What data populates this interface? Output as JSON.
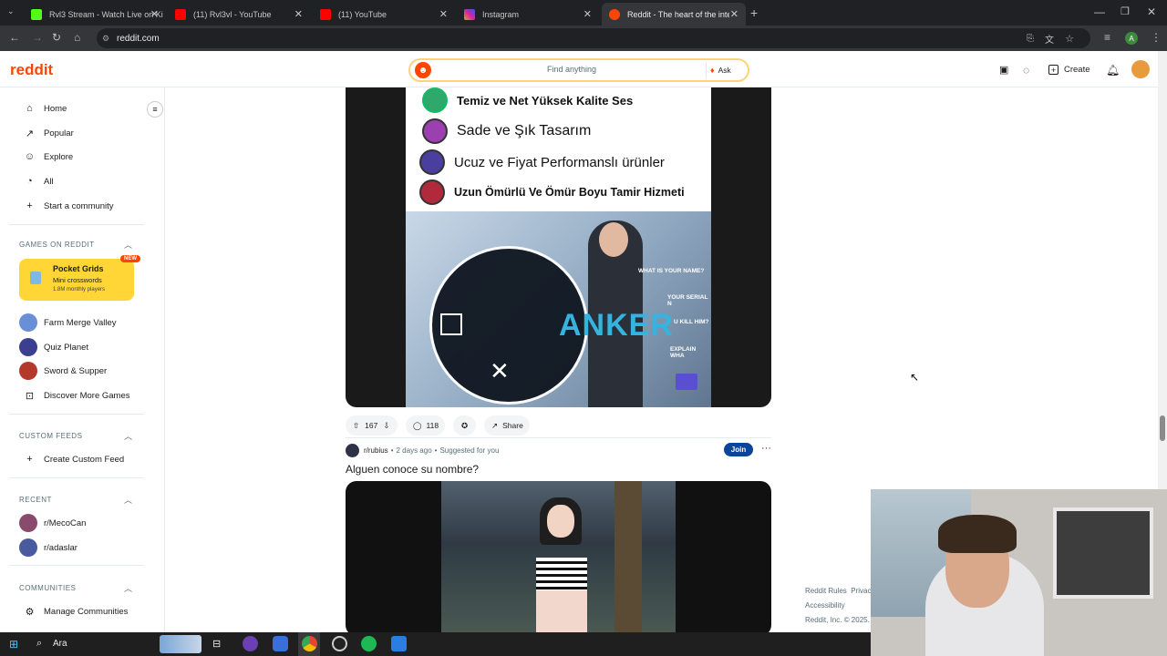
{
  "browser": {
    "tabs": [
      {
        "label": "Rvl3 Stream - Watch Live on Ki",
        "color": "#53fc18"
      },
      {
        "label": "(11) Rvl3vl - YouTube",
        "color": "#ff0000"
      },
      {
        "label": "(11) YouTube",
        "color": "#ff0000"
      },
      {
        "label": "Instagram",
        "color": "#d6249f"
      },
      {
        "label": "Reddit - The heart of the intern",
        "color": "#ff4500"
      }
    ],
    "url": "reddit.com",
    "profile_initial": "A"
  },
  "reddit_header": {
    "logo": "reddit",
    "search_placeholder": "Find anything",
    "ask_label": "Ask",
    "create_label": "Create"
  },
  "sidebar": {
    "nav": [
      {
        "label": "Home",
        "icon": "home-icon"
      },
      {
        "label": "Popular",
        "icon": "popular-icon"
      },
      {
        "label": "Explore",
        "icon": "explore-icon"
      },
      {
        "label": "All",
        "icon": "all-icon"
      },
      {
        "label": "Start a community",
        "icon": "plus-icon"
      }
    ],
    "games_heading": "GAMES ON REDDIT",
    "featured_game": {
      "title": "Pocket Grids",
      "subtitle": "Mini crosswords",
      "players": "1.8M monthly players",
      "badge": "NEW"
    },
    "games": [
      "Farm Merge Valley",
      "Quiz Planet",
      "Sword & Supper",
      "Discover More Games"
    ],
    "custom_feeds_heading": "CUSTOM FEEDS",
    "create_custom_feed": "Create Custom Feed",
    "recent_heading": "RECENT",
    "recent": [
      "r/MecoCan",
      "r/adaslar"
    ],
    "communities_heading": "COMMUNITIES",
    "manage_communities": "Manage Communities"
  },
  "post1": {
    "lines": [
      "Temiz ve Net Yüksek Kalite Ses",
      "Sade ve Şık Tasarım",
      "Ucuz ve Fiyat Performanslı ürünler",
      "Uzun Ömürlü Ve Ömür Boyu Tamir Hizmeti"
    ],
    "brand": "ANKER",
    "overlay_texts": [
      "WHAT IS YOUR NAME?",
      "YOUR SERIAL N",
      "U KILL HIM?",
      "EXPLAIN WHA"
    ],
    "votes": "167",
    "comments": "118",
    "share_label": "Share"
  },
  "post2": {
    "subreddit": "r/rubius",
    "time": "2 days ago",
    "suggested": "Suggested for you",
    "join_label": "Join",
    "title": "Alguen conoce su nombre?"
  },
  "footer": {
    "rules": "Reddit Rules",
    "privacy": "Privac",
    "accessibility": "Accessibility",
    "copyright": "Reddit, Inc. © 2025."
  },
  "taskbar": {
    "search_placeholder": "Ara"
  }
}
